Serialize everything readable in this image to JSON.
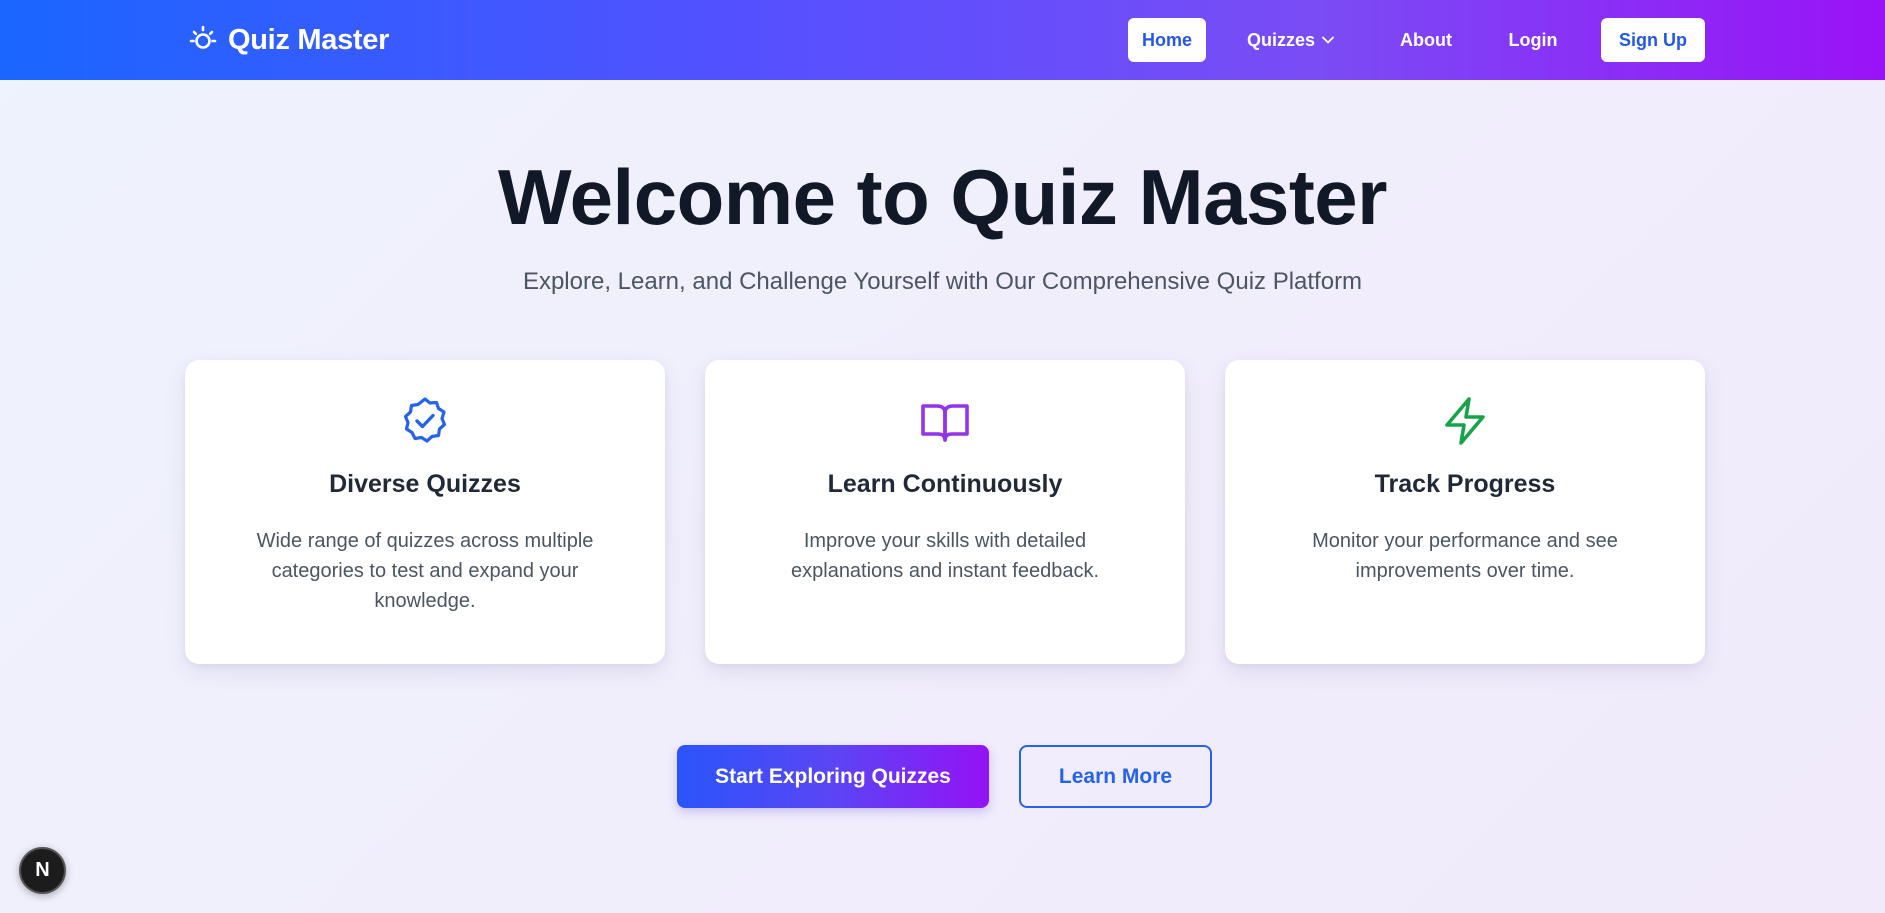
{
  "navbar": {
    "brand_name": "Quiz Master",
    "brand_icon": "sun-icon",
    "items": {
      "home": "Home",
      "quizzes": "Quizzes",
      "about": "About",
      "login": "Login",
      "signup": "Sign Up"
    },
    "active": "Home"
  },
  "hero": {
    "title": "Welcome to Quiz Master",
    "subtitle": "Explore, Learn, and Challenge Yourself with Our Comprehensive Quiz Platform"
  },
  "features": [
    {
      "icon": "badge-check-icon",
      "title": "Diverse Quizzes",
      "description": "Wide range of quizzes across multiple categories to test and expand your knowledge.",
      "icon_color": "#2563eb"
    },
    {
      "icon": "book-open-icon",
      "title": "Learn Continuously",
      "description": "Improve your skills with detailed explanations and instant feedback.",
      "icon_color": "#9333ea"
    },
    {
      "icon": "lightning-icon",
      "title": "Track Progress",
      "description": "Monitor your performance and see improvements over time.",
      "icon_color": "#16a34a"
    }
  ],
  "cta": {
    "primary": "Start Exploring Quizzes",
    "secondary": "Learn More"
  },
  "dev_badge": {
    "label": "N"
  },
  "colors": {
    "nav_gradient_start": "#1a66ff",
    "nav_gradient_end": "#9a12f7",
    "accent_blue": "#2563eb",
    "accent_purple": "#9333ea",
    "accent_green": "#16a34a"
  }
}
